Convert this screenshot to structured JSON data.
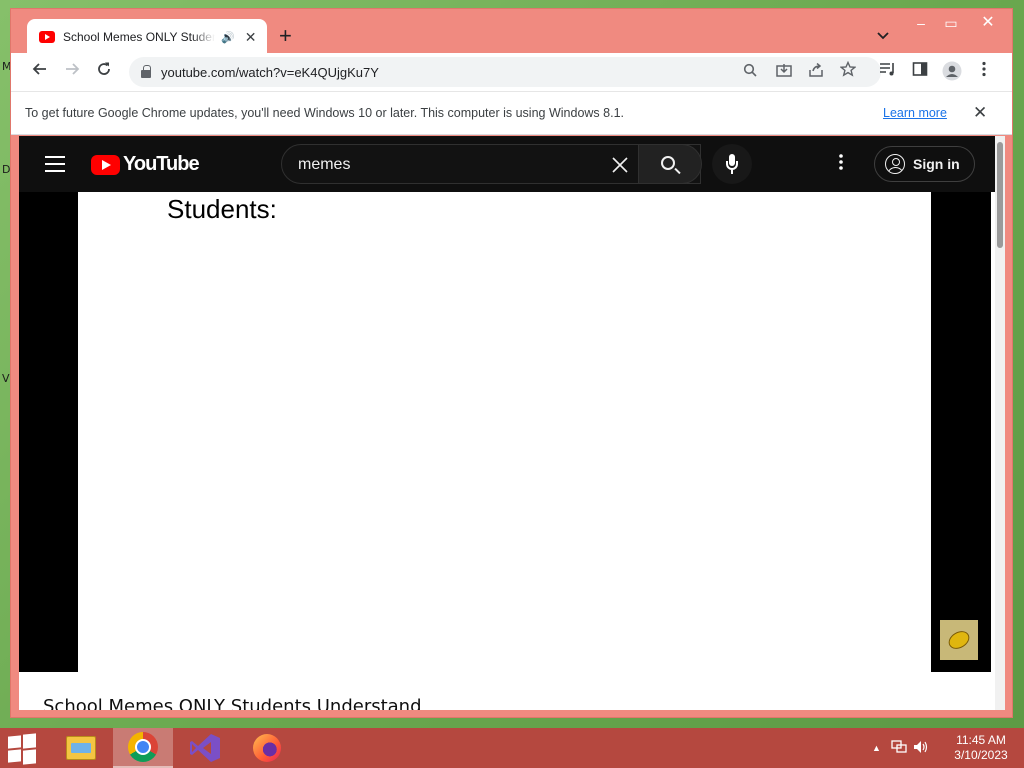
{
  "desktop": {
    "side_letters": [
      "M",
      "D",
      "V"
    ]
  },
  "window": {
    "tab_title": "School Memes ONLY Students Understand",
    "tab_audio_icon": "speaker-icon",
    "new_tab_label": "+",
    "tab_search_label": "⌄",
    "minimize_label": "–",
    "maximize_label": "▭",
    "close_label": "✕"
  },
  "toolbar": {
    "url": "youtube.com/watch?v=eK4QUjgKu7Y"
  },
  "infobar": {
    "message": "To get future Google Chrome updates, you'll need Windows 10 or later. This computer is using Windows 8.1.",
    "learn_more": "Learn more"
  },
  "youtube": {
    "logo_text": "YouTube",
    "search_value": "memes",
    "sign_in_label": "Sign in",
    "video_caption": "Students:",
    "video_title": "School Memes ONLY Students Understand"
  },
  "taskbar": {
    "apps": [
      "file-explorer",
      "chrome",
      "visual-studio",
      "firefox"
    ],
    "time": "11:45 AM",
    "date": "3/10/2023"
  },
  "colors": {
    "chrome_frame": "#f08a80",
    "youtube_header": "#0f0f0f",
    "taskbar": "#b5483f",
    "link": "#1a73e8"
  }
}
